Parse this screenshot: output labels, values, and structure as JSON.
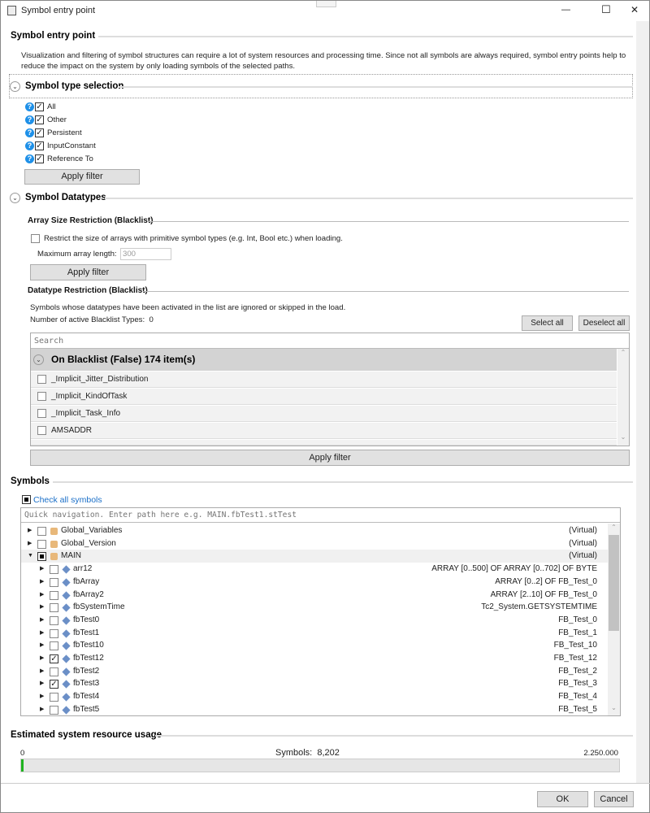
{
  "window": {
    "title": "Symbol entry point",
    "minimize": "—",
    "maximize": "☐",
    "close": "✕"
  },
  "entry": {
    "heading": "Symbol entry point",
    "desc1": "Visualization and filtering of symbol structures can require a lot of system resources and processing time. Since not all symbols are always required, symbol entry points help to",
    "desc2": "reduce the impact on the system by only loading symbols of the selected paths."
  },
  "type_selection": {
    "heading": "Symbol type selection",
    "items": [
      {
        "label": "All",
        "checked": true
      },
      {
        "label": "Other",
        "checked": true
      },
      {
        "label": "Persistent",
        "checked": true
      },
      {
        "label": "InputConstant",
        "checked": true
      },
      {
        "label": "Reference To",
        "checked": true
      }
    ],
    "apply": "Apply filter"
  },
  "datatypes": {
    "heading": "Symbol Datatypes",
    "array": {
      "heading": "Array Size Restriction (Blacklist)",
      "restrict_label": "Restrict the size of arrays with primitive symbol types (e.g. Int, Bool etc.) when loading.",
      "restrict_checked": false,
      "max_label": "Maximum array length:",
      "max_value": "300",
      "apply": "Apply filter"
    },
    "restriction": {
      "heading": "Datatype Restriction (Blacklist)",
      "desc": "Symbols whose datatypes have been activated in the list are ignored or skipped in the load.",
      "count_label": "Number of active Blacklist Types:",
      "count": "0",
      "select_all": "Select all",
      "deselect_all": "Deselect all",
      "search_placeholder": "Search",
      "group": "On Blacklist (False) 174 item(s)",
      "items": [
        "_Implicit_Jitter_Distribution",
        "_Implicit_KindOfTask",
        "_Implicit_Task_Info",
        "AMSADDR"
      ],
      "apply": "Apply filter"
    }
  },
  "symbols": {
    "heading": "Symbols",
    "check_all": "Check all symbols",
    "nav_placeholder": "Quick navigation. Enter path here e.g. MAIN.fbTest1.stTest",
    "rows": [
      {
        "name": "Global_Variables",
        "type": "(Virtual)",
        "level": 0,
        "state": "unchecked",
        "expanded": false,
        "icon": "folder-icon"
      },
      {
        "name": "Global_Version",
        "type": "(Virtual)",
        "level": 0,
        "state": "unchecked",
        "expanded": false,
        "icon": "folder-icon"
      },
      {
        "name": "MAIN",
        "type": "(Virtual)",
        "level": 0,
        "state": "partial",
        "expanded": true,
        "icon": "folder-icon"
      },
      {
        "name": "arr12",
        "type": "ARRAY [0..500] OF ARRAY [0..702] OF BYTE",
        "level": 1,
        "state": "unchecked"
      },
      {
        "name": "fbArray",
        "type": "ARRAY [0..2] OF FB_Test_0",
        "level": 1,
        "state": "unchecked"
      },
      {
        "name": "fbArray2",
        "type": "ARRAY [2..10] OF FB_Test_0",
        "level": 1,
        "state": "unchecked"
      },
      {
        "name": "fbSystemTime",
        "type": "Tc2_System.GETSYSTEMTIME",
        "level": 1,
        "state": "unchecked"
      },
      {
        "name": "fbTest0",
        "type": "FB_Test_0",
        "level": 1,
        "state": "unchecked"
      },
      {
        "name": "fbTest1",
        "type": "FB_Test_1",
        "level": 1,
        "state": "unchecked"
      },
      {
        "name": "fbTest10",
        "type": "FB_Test_10",
        "level": 1,
        "state": "unchecked"
      },
      {
        "name": "fbTest12",
        "type": "FB_Test_12",
        "level": 1,
        "state": "checked"
      },
      {
        "name": "fbTest2",
        "type": "FB_Test_2",
        "level": 1,
        "state": "unchecked"
      },
      {
        "name": "fbTest3",
        "type": "FB_Test_3",
        "level": 1,
        "state": "checked"
      },
      {
        "name": "fbTest4",
        "type": "FB_Test_4",
        "level": 1,
        "state": "unchecked"
      },
      {
        "name": "fbTest5",
        "type": "FB_Test_5",
        "level": 1,
        "state": "unchecked"
      }
    ]
  },
  "usage": {
    "heading": "Estimated system resource usage",
    "min": "0",
    "max": "2.250.000",
    "symbols_label": "Symbols:",
    "symbols_value": "8,202",
    "fraction": 0.0036,
    "bar_color": "#1fb31f"
  },
  "footer": {
    "ok": "OK",
    "cancel": "Cancel"
  }
}
